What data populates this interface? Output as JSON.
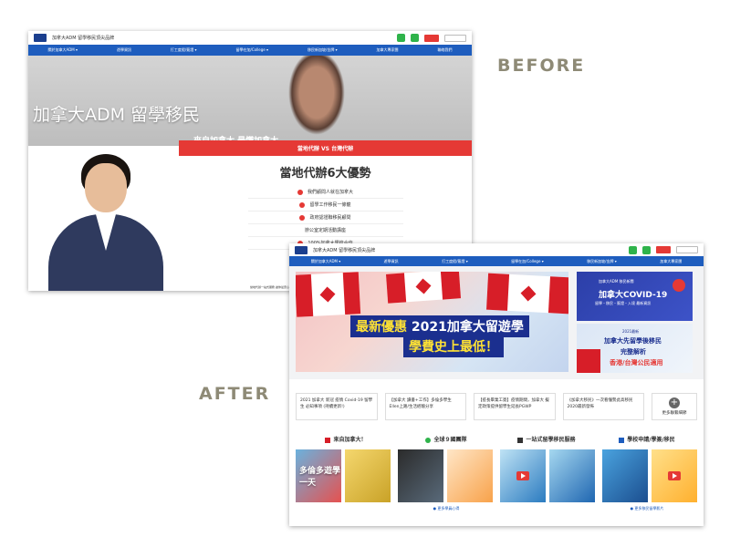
{
  "labels": {
    "before": "BEFORE",
    "after": "AFTER"
  },
  "before": {
    "brand": "加拿大ADM 留學移民頂尖品牌",
    "nav": [
      "關於加拿大ADM ▾",
      "遊學資訊",
      "打工度假/簽證 ▾",
      "留學在加/College ▾",
      "移民新加坡/金牌 ▾",
      "加拿大專家團",
      "聯絡我們"
    ],
    "hero_title": "加拿大ADM 留學移民",
    "hero_sub": "來自加拿大 最懂加拿大",
    "redbar": "當地代辦 VS 台灣代辦",
    "heading": "當地代辦6大優勢",
    "points": [
      "我們顧問人就在加拿大",
      "留學工作移民一條龍",
      "政府認證聯移民顧問",
      "辦公室定期活動講座",
      "100%加拿大學校合作"
    ],
    "footer": "當地代辦一站式服務 讓你最安心"
  },
  "after": {
    "brand": "加拿大ADM 留學移民頂尖品牌",
    "nav": [
      "關於加拿大ADM ▾",
      "遊學資訊",
      "打工度假/簽證 ▾",
      "留學在加/College ▾",
      "移民新加坡/金牌 ▾",
      "加拿大專家團"
    ],
    "promo_line1_a": "最新優惠",
    "promo_line1_b": " 2021加拿大留遊學",
    "promo_line2": "學費史上最低！",
    "card1_top": "加拿大ADM 移民新聞",
    "card1_title": "加拿大COVID-19",
    "card1_sub": "留學・移民・簽證・入境 最新資訊",
    "card2_top": "2021最新",
    "card2_l1": "加拿大先留學後移民",
    "card2_l2": "完整解析",
    "card2_l3": "香港/台灣公民適用",
    "news": [
      "2021 加拿大 新冠 疫情 Covid-19 留學生 必知事項 (持續更新!)",
      "【加拿大 讀書+工作】多倫多學生 Ellen上路/生活經驗分享",
      "【疫長畢業工簽】疫情期間，加拿大 擬定政策提供留學生延長PGWP",
      "《加拿大移民》一次看懂勢此高移民 2020最新發佈"
    ],
    "news_more": "更多聯繫細節",
    "sections": [
      "來自加拿大！",
      "全球９國團隊",
      "一站式留學移民服務",
      "學校申請/學簽/移民"
    ],
    "thumb_captions": [
      "多倫多遊學一天",
      "",
      "",
      "",
      "",
      "",
      "",
      ""
    ],
    "more_links": [
      "● 更多學員心得",
      "● 更多移民留學影片"
    ]
  },
  "colors": {
    "nav_blue": "#1e5dbe",
    "accent_red": "#e53935",
    "label_gray": "#8e8a76",
    "dark_blue": "#1b2f8f"
  }
}
